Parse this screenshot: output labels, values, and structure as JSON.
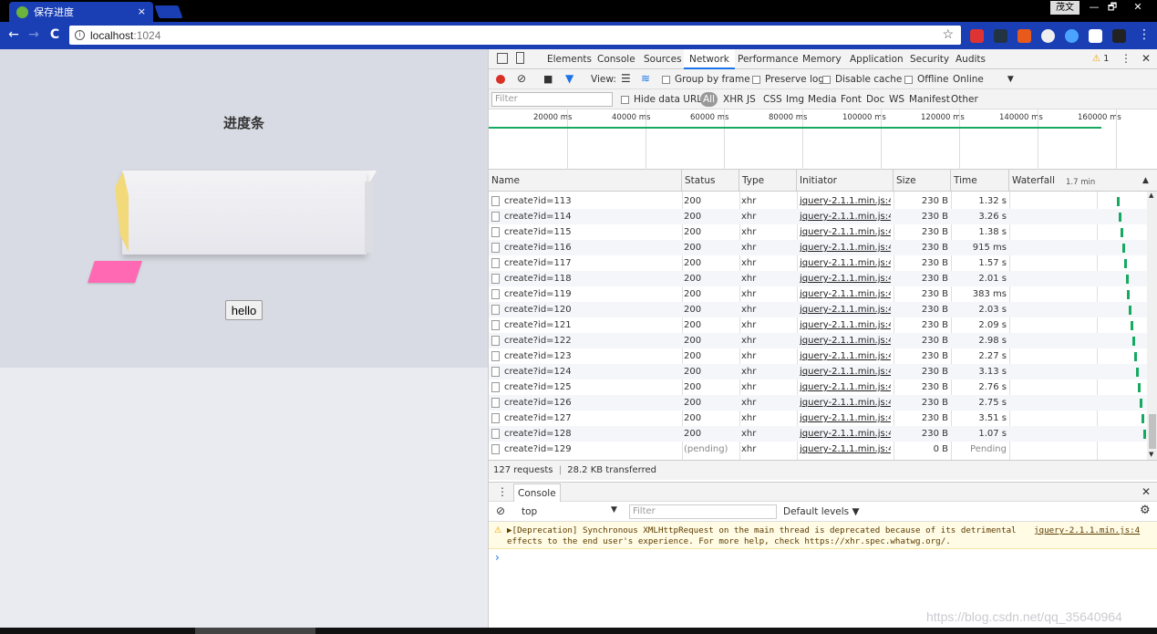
{
  "browser": {
    "tab_title": "保存进度",
    "tab_close": "×",
    "user_name": "茂文",
    "win_minimize": "—",
    "win_restore": "🗗",
    "win_close": "✕",
    "url_host": "localhost",
    "url_port": ":1024",
    "back_icon": "←",
    "forward_icon": "→",
    "reload_icon": "C",
    "star_icon": "☆"
  },
  "page": {
    "title": "进度条",
    "hello_button": "hello"
  },
  "devtools": {
    "tabs": [
      "Elements",
      "Console",
      "Sources",
      "Network",
      "Performance",
      "Memory",
      "Application",
      "Security",
      "Audits"
    ],
    "active_tab": "Network",
    "warning_count": "1",
    "toolbar": {
      "view_label": "View:",
      "group_by_frame": "Group by frame",
      "preserve_log": "Preserve log",
      "disable_cache": "Disable cache",
      "offline": "Offline",
      "throttle": "Online"
    },
    "filter": {
      "placeholder": "Filter",
      "hide_data_urls": "Hide data URLs",
      "types": [
        "All",
        "XHR",
        "JS",
        "CSS",
        "Img",
        "Media",
        "Font",
        "Doc",
        "WS",
        "Manifest",
        "Other"
      ]
    },
    "overview_ticks": [
      "20000 ms",
      "40000 ms",
      "60000 ms",
      "80000 ms",
      "100000 ms",
      "120000 ms",
      "140000 ms",
      "160000 ms"
    ],
    "columns": {
      "name": "Name",
      "status": "Status",
      "type": "Type",
      "initiator": "Initiator",
      "size": "Size",
      "time": "Time",
      "waterfall": "Waterfall",
      "waterfall_scale": "1.7 min"
    },
    "rows": [
      {
        "name": "create?id=113",
        "status": "200",
        "type": "xhr",
        "initiator": "jquery-2.1.1.min.js:4",
        "size": "230 B",
        "time": "1.32 s"
      },
      {
        "name": "create?id=114",
        "status": "200",
        "type": "xhr",
        "initiator": "jquery-2.1.1.min.js:4",
        "size": "230 B",
        "time": "3.26 s"
      },
      {
        "name": "create?id=115",
        "status": "200",
        "type": "xhr",
        "initiator": "jquery-2.1.1.min.js:4",
        "size": "230 B",
        "time": "1.38 s"
      },
      {
        "name": "create?id=116",
        "status": "200",
        "type": "xhr",
        "initiator": "jquery-2.1.1.min.js:4",
        "size": "230 B",
        "time": "915 ms"
      },
      {
        "name": "create?id=117",
        "status": "200",
        "type": "xhr",
        "initiator": "jquery-2.1.1.min.js:4",
        "size": "230 B",
        "time": "1.57 s"
      },
      {
        "name": "create?id=118",
        "status": "200",
        "type": "xhr",
        "initiator": "jquery-2.1.1.min.js:4",
        "size": "230 B",
        "time": "2.01 s"
      },
      {
        "name": "create?id=119",
        "status": "200",
        "type": "xhr",
        "initiator": "jquery-2.1.1.min.js:4",
        "size": "230 B",
        "time": "383 ms"
      },
      {
        "name": "create?id=120",
        "status": "200",
        "type": "xhr",
        "initiator": "jquery-2.1.1.min.js:4",
        "size": "230 B",
        "time": "2.03 s"
      },
      {
        "name": "create?id=121",
        "status": "200",
        "type": "xhr",
        "initiator": "jquery-2.1.1.min.js:4",
        "size": "230 B",
        "time": "2.09 s"
      },
      {
        "name": "create?id=122",
        "status": "200",
        "type": "xhr",
        "initiator": "jquery-2.1.1.min.js:4",
        "size": "230 B",
        "time": "2.98 s"
      },
      {
        "name": "create?id=123",
        "status": "200",
        "type": "xhr",
        "initiator": "jquery-2.1.1.min.js:4",
        "size": "230 B",
        "time": "2.27 s"
      },
      {
        "name": "create?id=124",
        "status": "200",
        "type": "xhr",
        "initiator": "jquery-2.1.1.min.js:4",
        "size": "230 B",
        "time": "3.13 s"
      },
      {
        "name": "create?id=125",
        "status": "200",
        "type": "xhr",
        "initiator": "jquery-2.1.1.min.js:4",
        "size": "230 B",
        "time": "2.76 s"
      },
      {
        "name": "create?id=126",
        "status": "200",
        "type": "xhr",
        "initiator": "jquery-2.1.1.min.js:4",
        "size": "230 B",
        "time": "2.75 s"
      },
      {
        "name": "create?id=127",
        "status": "200",
        "type": "xhr",
        "initiator": "jquery-2.1.1.min.js:4",
        "size": "230 B",
        "time": "3.51 s"
      },
      {
        "name": "create?id=128",
        "status": "200",
        "type": "xhr",
        "initiator": "jquery-2.1.1.min.js:4",
        "size": "230 B",
        "time": "1.07 s"
      },
      {
        "name": "create?id=129",
        "status": "(pending)",
        "type": "xhr",
        "initiator": "jquery-2.1.1.min.js:4",
        "size": "0 B",
        "time": "Pending"
      }
    ],
    "summary_requests": "127 requests",
    "summary_sep": "|",
    "summary_transferred": "28.2 KB transferred"
  },
  "console": {
    "tab_label": "Console",
    "context": "top",
    "filter_placeholder": "Filter",
    "levels": "Default levels ▼",
    "warning_line1": "▶[Deprecation] Synchronous XMLHttpRequest on the main thread is deprecated because of its detrimental",
    "warning_line2_prefix": "effects to the end user's experience. For more help, check ",
    "warning_link": "https://xhr.spec.whatwg.org/",
    "warning_line2_suffix": ".",
    "warning_source": "jquery-2.1.1.min.js:4",
    "prompt": "›"
  },
  "watermark": "https://blog.csdn.net/qq_35640964",
  "colors": {
    "chrome_blue": "#1a3fb5",
    "waterfall_green": "#16a960",
    "progress_pink": "#ff69b4",
    "box_yellow": "#f2d97a"
  }
}
